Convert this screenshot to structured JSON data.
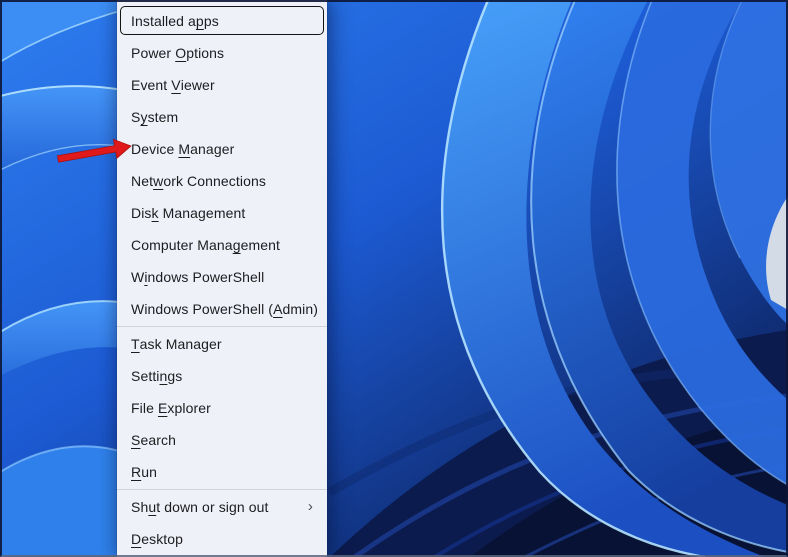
{
  "menu": {
    "submenu_chevron": "›",
    "items": [
      {
        "id": "installed-apps",
        "label": "Installed apps",
        "pre": "Installed a",
        "key": "p",
        "post": "ps",
        "focused": true
      },
      {
        "id": "power-options",
        "label": "Power Options",
        "pre": "Power ",
        "key": "O",
        "post": "ptions"
      },
      {
        "id": "event-viewer",
        "label": "Event Viewer",
        "pre": "Event ",
        "key": "V",
        "post": "iewer"
      },
      {
        "id": "system",
        "label": "System",
        "pre": "S",
        "key": "y",
        "post": "stem"
      },
      {
        "id": "device-manager",
        "label": "Device Manager",
        "pre": "Device ",
        "key": "M",
        "post": "anager"
      },
      {
        "id": "network-connections",
        "label": "Network Connections",
        "pre": "Net",
        "key": "w",
        "post": "ork Connections"
      },
      {
        "id": "disk-management",
        "label": "Disk Management",
        "pre": "Dis",
        "key": "k",
        "post": " Management"
      },
      {
        "id": "computer-management",
        "label": "Computer Management",
        "pre": "Computer Mana",
        "key": "g",
        "post": "ement"
      },
      {
        "id": "windows-powershell",
        "label": "Windows PowerShell",
        "pre": "W",
        "key": "i",
        "post": "ndows PowerShell"
      },
      {
        "id": "windows-powershell-admin",
        "label": "Windows PowerShell (Admin)",
        "pre": "Windows PowerShell (",
        "key": "A",
        "post": "dmin)"
      },
      {
        "separator": true
      },
      {
        "id": "task-manager",
        "label": "Task Manager",
        "pre": "",
        "key": "T",
        "post": "ask Manager"
      },
      {
        "id": "settings",
        "label": "Settings",
        "pre": "Setti",
        "key": "n",
        "post": "gs"
      },
      {
        "id": "file-explorer",
        "label": "File Explorer",
        "pre": "File ",
        "key": "E",
        "post": "xplorer"
      },
      {
        "id": "search",
        "label": "Search",
        "pre": "",
        "key": "S",
        "post": "earch"
      },
      {
        "id": "run",
        "label": "Run",
        "pre": "",
        "key": "R",
        "post": "un"
      },
      {
        "separator": true
      },
      {
        "id": "shut-down-or-sign-out",
        "label": "Shut down or sign out",
        "pre": "Sh",
        "key": "u",
        "post": "t down or sign out",
        "submenu": true
      },
      {
        "id": "desktop",
        "label": "Desktop",
        "pre": "",
        "key": "D",
        "post": "esktop"
      }
    ]
  },
  "annotation": {
    "arrow_color": "#e01a1a",
    "arrow_points_to": "Device Manager"
  },
  "colors": {
    "menu_background": "#eef1f8",
    "menu_text": "#1d1d1f",
    "separator": "#ced2da",
    "focus_ring": "#141414",
    "wallpaper_primary_blue": "#2e7ef0",
    "wallpaper_dark_navy": "#0a1747"
  }
}
